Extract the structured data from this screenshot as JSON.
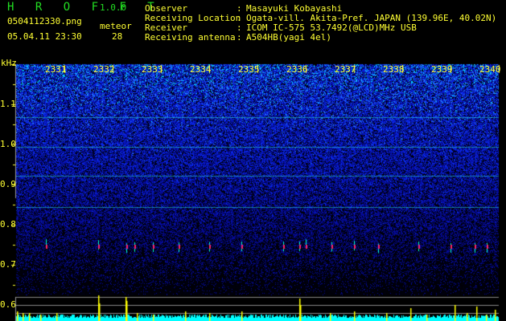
{
  "header": {
    "app_name": "H R O F F T",
    "version": "1.0.0",
    "filename": "0504112330.png",
    "datetime": "05.04.11 23:30",
    "meteor_label": "meteor",
    "meteor_count": "28"
  },
  "station": [
    {
      "label": "Observer",
      "value": "Masayuki Kobayashi"
    },
    {
      "label": "Receiving Location",
      "value": "Ogata-vill. Akita-Pref. JAPAN (139.96E, 40.02N)"
    },
    {
      "label": "Receiver",
      "value": "ICOM IC-575 53.7492(@LCD)MHz USB"
    },
    {
      "label": "Receiving antenna",
      "value": "A504HB(yagi 4el)"
    }
  ],
  "axis": {
    "y_unit": "kHz",
    "y_ticks": [
      "1.1",
      "1.0",
      "0.9",
      "0.8",
      "0.7",
      "0.6"
    ],
    "x_ticks": [
      "2331",
      "2332",
      "2333",
      "2334",
      "2335",
      "2336",
      "2337",
      "2338",
      "2339",
      "2340"
    ]
  },
  "colors": {
    "text": "#ffff33",
    "logo": "#22dd22",
    "histogram": "#00ffff",
    "spike": "#ffff00",
    "background": "#000000"
  }
}
